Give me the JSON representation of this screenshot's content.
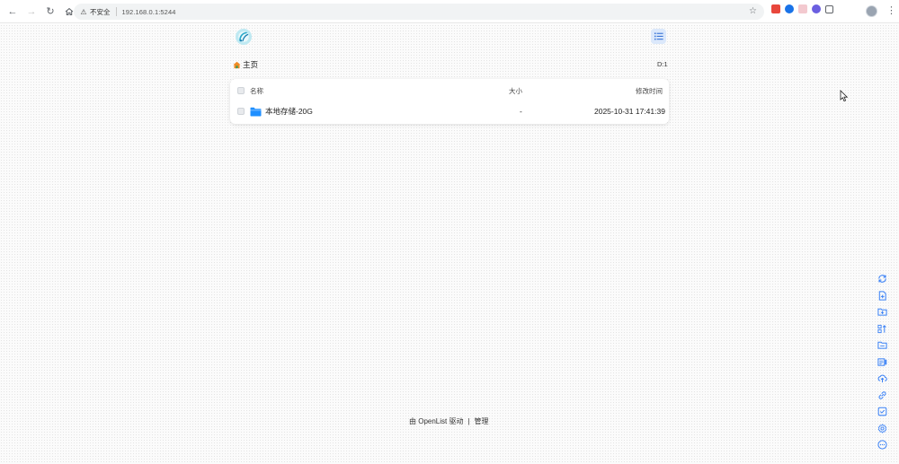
{
  "browser": {
    "insecure_label": "不安全",
    "url": "192.168.0.1:5244"
  },
  "header": {
    "breadcrumb_home": "主页",
    "disk_label": "D:1"
  },
  "file_list": {
    "columns": {
      "name": "名称",
      "size": "大小",
      "modified": "修改时间"
    },
    "items": [
      {
        "name": "本地存储-20G",
        "size": "-",
        "modified": "2025-10-31 17:41:39"
      }
    ]
  },
  "footer": {
    "powered_by": "由 OpenList 驱动",
    "separator": "|",
    "admin_link": "管理"
  },
  "colors": {
    "accent": "#1a73e8",
    "folder": "#1f8fff",
    "page_background": "#fbfbfb"
  },
  "right_toolbar_icons": [
    "refresh-icon",
    "new-file-icon",
    "new-folder-icon",
    "sort-icon",
    "folder-move-icon",
    "storage-icon",
    "upload-icon",
    "link-icon",
    "checkbox-icon",
    "settings-icon",
    "more-icon"
  ]
}
